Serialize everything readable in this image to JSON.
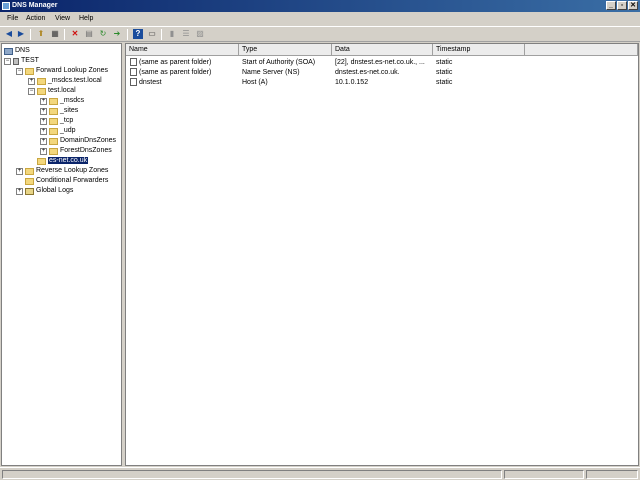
{
  "window": {
    "title": "DNS Manager"
  },
  "menu": [
    "File",
    "Action",
    "View",
    "Help"
  ],
  "tree": {
    "root": "DNS",
    "server": "TEST",
    "forward_zones": "Forward Lookup Zones",
    "msdcs_zone": "_msdcs.test.local",
    "test_local": "test.local",
    "children": [
      "_msdcs",
      "_sites",
      "_tcp",
      "_udp",
      "DomainDnsZones",
      "ForestDnsZones"
    ],
    "selected_zone": "es-net.co.uk",
    "reverse_zones": "Reverse Lookup Zones",
    "conditional_forwarders": "Conditional Forwarders",
    "global_logs": "Global Logs"
  },
  "list": {
    "columns": [
      "Name",
      "Type",
      "Data",
      "Timestamp"
    ],
    "rows": [
      {
        "name": "(same as parent folder)",
        "type": "Start of Authority (SOA)",
        "data": "[22], dnstest.es-net.co.uk., ...",
        "timestamp": "static"
      },
      {
        "name": "(same as parent folder)",
        "type": "Name Server (NS)",
        "data": "dnstest.es-net.co.uk.",
        "timestamp": "static"
      },
      {
        "name": "dnstest",
        "type": "Host (A)",
        "data": "10.1.0.152",
        "timestamp": "static"
      }
    ]
  },
  "controls": {
    "minimize": "_",
    "maximize": "▫",
    "close": "✕"
  }
}
